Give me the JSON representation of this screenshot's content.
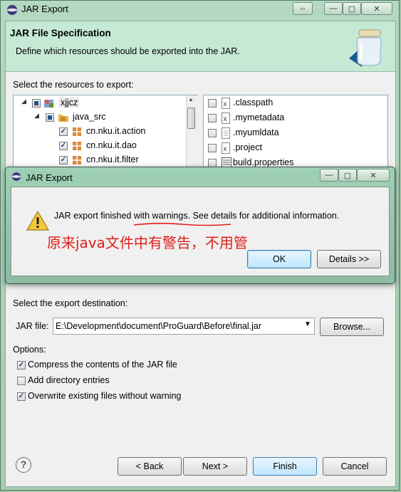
{
  "window": {
    "title": "JAR Export",
    "buttons": {
      "switch": "⇔",
      "minimize": "—",
      "maximize": "▢",
      "close": "✕"
    }
  },
  "banner": {
    "title": "JAR File Specification",
    "description": "Define which resources should be exported into the JAR."
  },
  "resources": {
    "label": "Select the resources to export:",
    "tree": [
      {
        "label": "xjjcz",
        "checked": "partial"
      },
      {
        "label": "java_src",
        "checked": "partial"
      },
      {
        "label": "cn.nku.it.action",
        "checked": "checked"
      },
      {
        "label": "cn.nku.it.dao",
        "checked": "checked"
      },
      {
        "label": "cn.nku.it.filter",
        "checked": "checked"
      }
    ],
    "files": [
      {
        "label": ".classpath",
        "icon": "x-file-icon"
      },
      {
        "label": ".mymetadata",
        "icon": "x-file-icon"
      },
      {
        "label": ".myumldata",
        "icon": "text-file-icon"
      },
      {
        "label": ".project",
        "icon": "x-file-icon"
      },
      {
        "label": "build.properties",
        "icon": "properties-file-icon"
      }
    ]
  },
  "dialog": {
    "title": "JAR Export",
    "message": "JAR export finished with warnings. See details for additional information.",
    "annotation": "原来java文件中有警告，不用管",
    "ok_label": "OK",
    "details_label": "Details >>"
  },
  "destination": {
    "label": "Select the export destination:",
    "jar_label": "JAR file:",
    "jar_value": "E:\\Development\\document\\ProGuard\\Before\\final.jar",
    "browse_label": "Browse..."
  },
  "options": {
    "label": "Options:",
    "items": [
      {
        "label": "Compress the contents of the JAR file",
        "checked": true
      },
      {
        "label": "Add directory entries",
        "checked": false
      },
      {
        "label": "Overwrite existing files without warning",
        "checked": true
      }
    ]
  },
  "footer": {
    "help": "?",
    "back_label": "< Back",
    "next_label": "Next >",
    "finish_label": "Finish",
    "cancel_label": "Cancel"
  },
  "colors": {
    "window_frame": "#a7ccb4",
    "banner": "#c6e9d5",
    "annotation": "#e0201a",
    "focus": "#3c7fb1"
  }
}
